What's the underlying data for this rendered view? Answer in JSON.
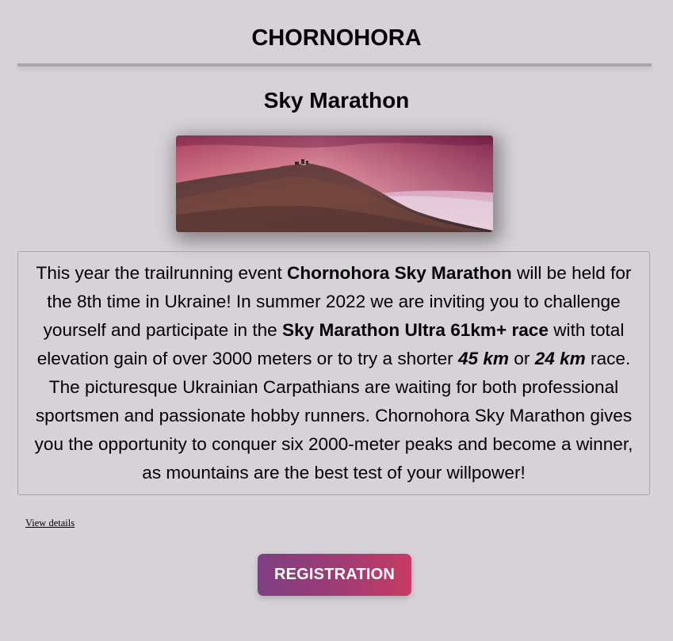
{
  "header": {
    "site_title": "CHORNOHORA"
  },
  "event": {
    "title": "Sky Marathon",
    "hero_image": "mountain-peak-sunset-photo",
    "description": {
      "p1": "This year the trailrunning event ",
      "b1": "Chornohora Sky Marathon",
      "p2": " will be held for the 8th time in Ukraine! In summer 2022 we are inviting you to challenge yourself and participate in the ",
      "b2": "Sky Marathon Ultra 61km+ race",
      "p3": " with total elevation gain of over 3000 meters or to try a shorter ",
      "bi1": "45 km",
      "p4": " or ",
      "bi2": "24 km",
      "p5": " race. The picturesque Ukrainian Carpathians are waiting for both professional sportsmen and passionate hobby runners. Chornohora Sky Marathon gives you the opportunity to conquer six 2000-meter peaks and become a winner, as mountains are the best test of your willpower!"
    },
    "view_details_label": "View details",
    "registration_label": "REGISTRATION"
  },
  "colors": {
    "background": "#d6d2d8",
    "button_gradient_start": "#7d3f83",
    "button_gradient_end": "#c83b63"
  }
}
